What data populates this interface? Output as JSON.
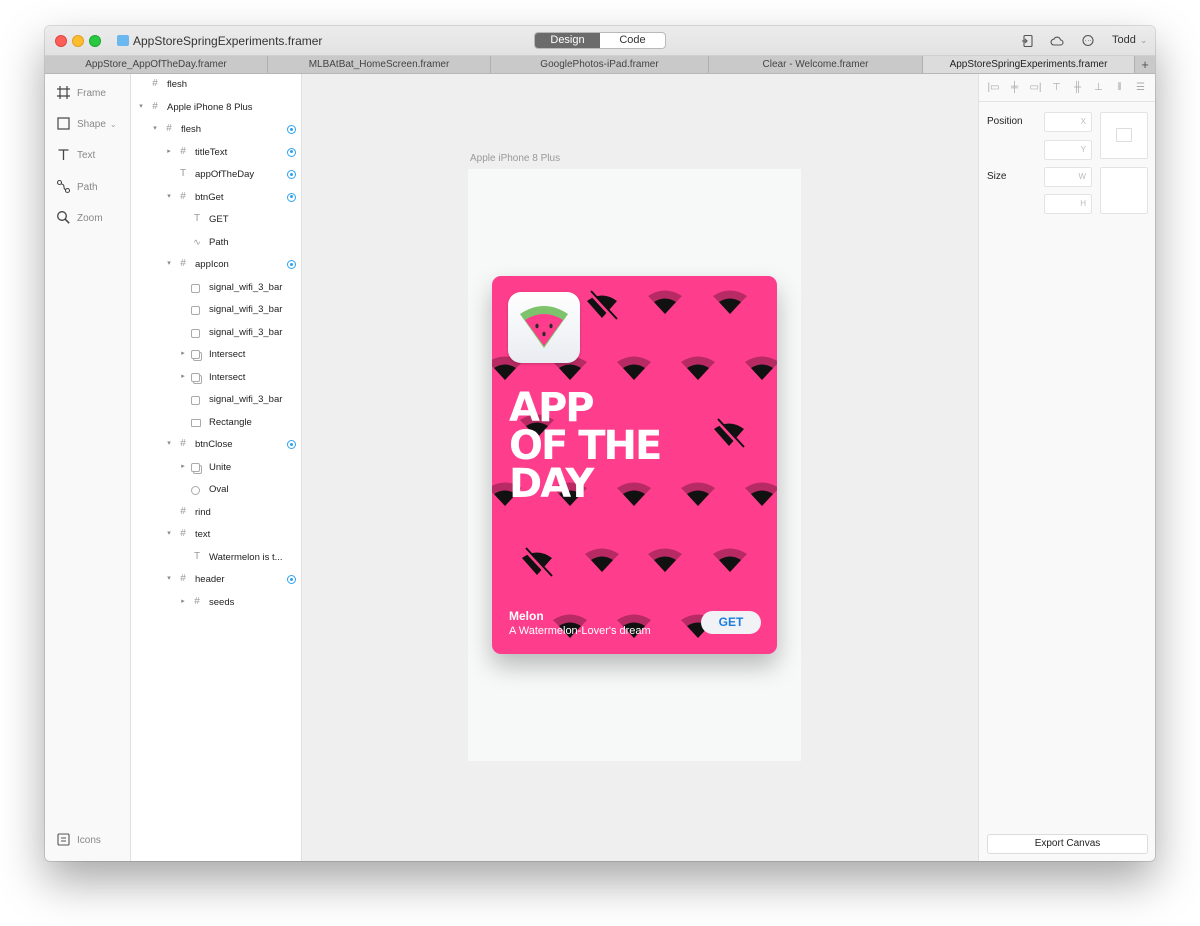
{
  "window": {
    "title": "AppStoreSpringExperiments.framer",
    "modes": [
      {
        "label": "Design",
        "active": true
      },
      {
        "label": "Code",
        "active": false
      }
    ],
    "user": "Todd"
  },
  "tabs": [
    {
      "label": "AppStore_AppOfTheDay.framer",
      "active": false
    },
    {
      "label": "MLBAtBat_HomeScreen.framer",
      "active": false
    },
    {
      "label": "GooglePhotos-iPad.framer",
      "active": false
    },
    {
      "label": "Clear - Welcome.framer",
      "active": false
    },
    {
      "label": "AppStoreSpringExperiments.framer",
      "active": true
    }
  ],
  "tools": [
    {
      "label": "Frame",
      "icon": "frame-icon"
    },
    {
      "label": "Shape",
      "icon": "shape-icon",
      "has_menu": true
    },
    {
      "label": "Text",
      "icon": "text-icon"
    },
    {
      "label": "Path",
      "icon": "path-icon"
    },
    {
      "label": "Zoom",
      "icon": "zoom-icon"
    },
    {
      "label": "Icons",
      "icon": "icons-icon"
    }
  ],
  "layers": [
    {
      "name": "flesh",
      "type": "frame",
      "depth": 0,
      "expanded": null,
      "target": false
    },
    {
      "name": "Apple iPhone 8 Plus",
      "type": "frame",
      "depth": 0,
      "expanded": true,
      "target": false
    },
    {
      "name": "flesh",
      "type": "frame",
      "depth": 1,
      "expanded": true,
      "target": true
    },
    {
      "name": "titleText",
      "type": "frame",
      "depth": 2,
      "expanded": false,
      "target": true
    },
    {
      "name": "appOfTheDay",
      "type": "text",
      "depth": 2,
      "expanded": null,
      "target": true
    },
    {
      "name": "btnGet",
      "type": "frame",
      "depth": 2,
      "expanded": true,
      "target": true
    },
    {
      "name": "GET",
      "type": "text",
      "depth": 3,
      "expanded": null,
      "target": false
    },
    {
      "name": "Path",
      "type": "path",
      "depth": 3,
      "expanded": null,
      "target": false
    },
    {
      "name": "appIcon",
      "type": "frame",
      "depth": 2,
      "expanded": true,
      "target": true
    },
    {
      "name": "signal_wifi_3_bar",
      "type": "box",
      "depth": 3,
      "expanded": null,
      "target": false
    },
    {
      "name": "signal_wifi_3_bar",
      "type": "box",
      "depth": 3,
      "expanded": null,
      "target": false
    },
    {
      "name": "signal_wifi_3_bar",
      "type": "box",
      "depth": 3,
      "expanded": null,
      "target": false
    },
    {
      "name": "Intersect",
      "type": "boolean",
      "depth": 3,
      "expanded": false,
      "target": false
    },
    {
      "name": "Intersect",
      "type": "boolean",
      "depth": 3,
      "expanded": false,
      "target": false
    },
    {
      "name": "signal_wifi_3_bar",
      "type": "box",
      "depth": 3,
      "expanded": null,
      "target": false
    },
    {
      "name": "Rectangle",
      "type": "rect",
      "depth": 3,
      "expanded": null,
      "target": false
    },
    {
      "name": "btnClose",
      "type": "frame",
      "depth": 2,
      "expanded": true,
      "target": true
    },
    {
      "name": "Unite",
      "type": "boolean",
      "depth": 3,
      "expanded": false,
      "target": false
    },
    {
      "name": "Oval",
      "type": "oval",
      "depth": 3,
      "expanded": null,
      "target": false
    },
    {
      "name": "rind",
      "type": "frame",
      "depth": 2,
      "expanded": null,
      "target": false
    },
    {
      "name": "text",
      "type": "frame",
      "depth": 2,
      "expanded": true,
      "target": false
    },
    {
      "name": "Watermelon is t...",
      "type": "text",
      "depth": 3,
      "expanded": null,
      "target": false
    },
    {
      "name": "header",
      "type": "frame",
      "depth": 2,
      "expanded": true,
      "target": true
    },
    {
      "name": "seeds",
      "type": "frame",
      "depth": 3,
      "expanded": false,
      "target": false
    }
  ],
  "canvas": {
    "device_label": "Apple iPhone 8 Plus",
    "card": {
      "headline": [
        "APP",
        "OF THE",
        "DAY"
      ],
      "app_name": "Melon",
      "app_subtitle": "A Watermelon-Lover's dream",
      "button_label": "GET",
      "background_color": "#fe3e8c"
    }
  },
  "inspector": {
    "position_label": "Position",
    "size_label": "Size",
    "x_label": "X",
    "y_label": "Y",
    "w_label": "W",
    "h_label": "H",
    "export_label": "Export Canvas"
  },
  "colors": {
    "accent": "#2ea3f2",
    "card_pink": "#fe3e8c",
    "get_blue": "#1a7ce0"
  }
}
